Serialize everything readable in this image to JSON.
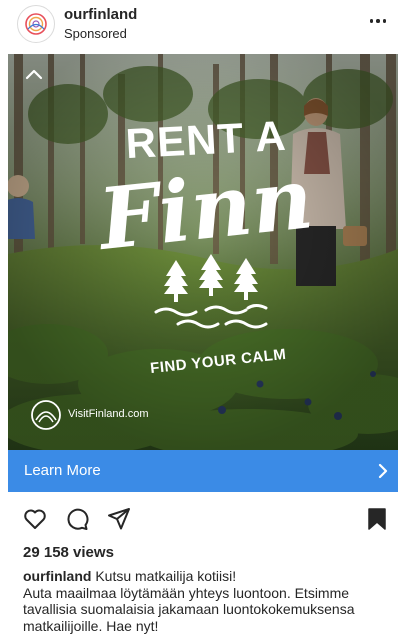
{
  "post": {
    "account_name": "ourfinland",
    "sponsored_label": "Sponsored",
    "views": "29 158 views",
    "caption_user": "ourfinland",
    "caption_first_line": "Kutsu matkailija kotiisi!",
    "caption_body": "Auta maailmaa löytämään yhteys luontoon. Etsimme tavallisia suomalaisia jakamaan luontokokemuksensa matkailijoille. Hae nyt!"
  },
  "ad_creative": {
    "headline_top": "RENT A",
    "headline_script": "Finn",
    "tagline": "FIND YOUR CALM",
    "brand_logo_text": "VisitFinland.com"
  },
  "cta": {
    "label": "Learn More",
    "color": "#3b8be6",
    "icon": "chevron-right-icon"
  },
  "actions": {
    "icons": [
      "heart-icon",
      "comment-icon",
      "share-icon",
      "bookmark-icon"
    ]
  }
}
